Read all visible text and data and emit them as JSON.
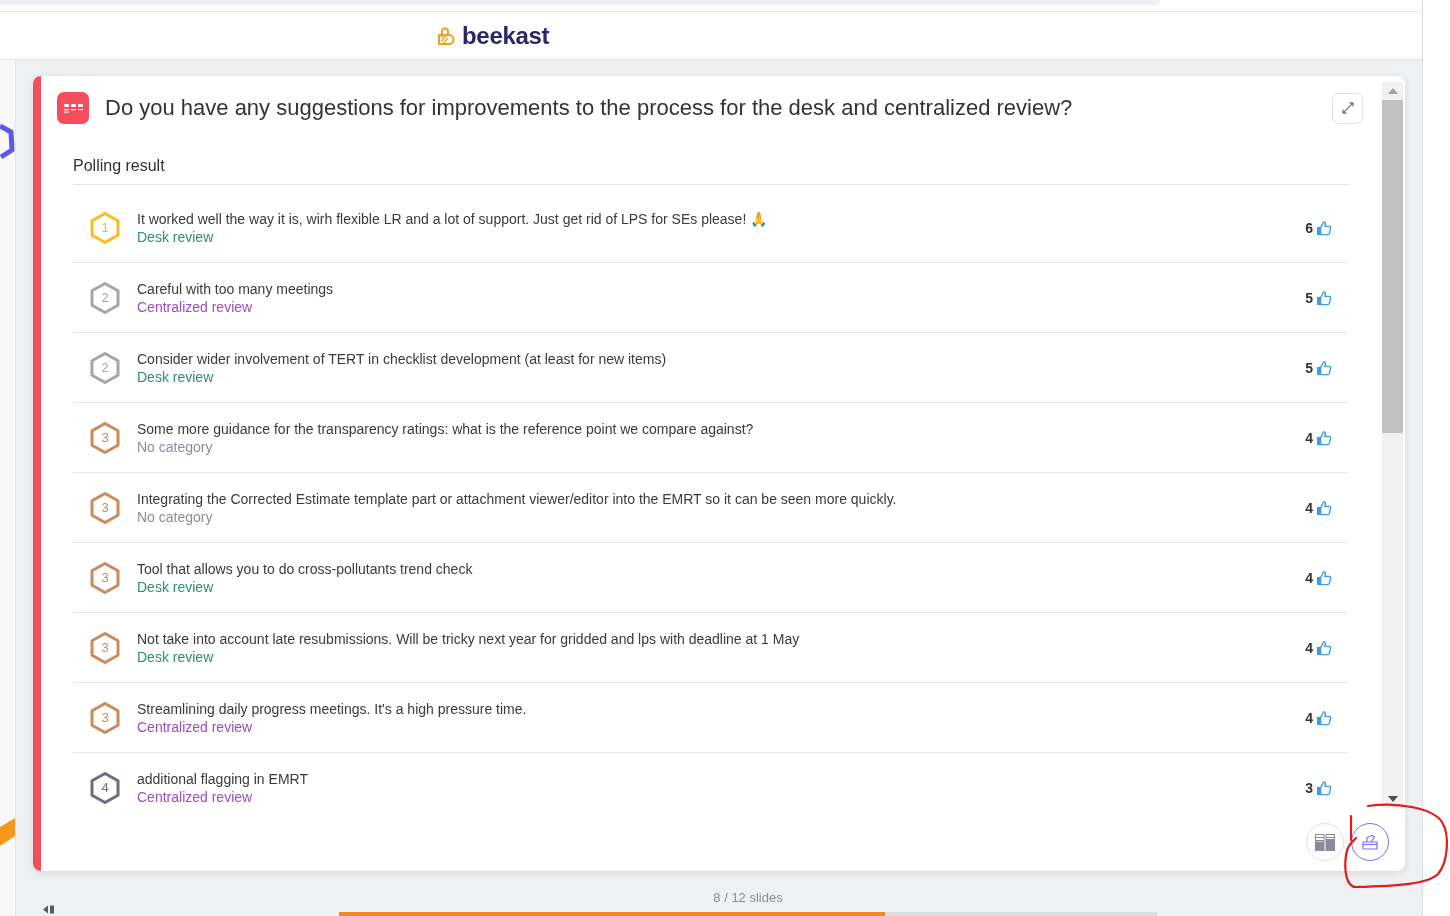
{
  "header": {
    "logo_text": "beekast"
  },
  "question": {
    "title": "Do you have any suggestions for improvements to the process for the desk and centralized review?",
    "section_title": "Polling result"
  },
  "results": [
    {
      "badge": {
        "rank": "1",
        "color": "#f5bd1f"
      },
      "text": "It worked well the way it is, wirh flexible LR and a lot of support. Just get rid of LPS for SEs please! 🙏",
      "category": {
        "label": "Desk review",
        "color": "#2b8f74"
      },
      "votes": "6"
    },
    {
      "badge": {
        "rank": "2",
        "color": "#a6a6a6"
      },
      "text": "Careful with too many meetings",
      "category": {
        "label": "Centralized review",
        "color": "#9b4dc2"
      },
      "votes": "5"
    },
    {
      "badge": {
        "rank": "2",
        "color": "#a6a6a6"
      },
      "text": "Consider wider involvement of TERT in checklist development (at least for new items)",
      "category": {
        "label": "Desk review",
        "color": "#2b8f74"
      },
      "votes": "5"
    },
    {
      "badge": {
        "rank": "3",
        "color": "#c98b5b"
      },
      "text": "Some more guidance for the transparency ratings: what is the reference point we compare against?",
      "category": {
        "label": "No category",
        "color": "#8c8c9c"
      },
      "votes": "4"
    },
    {
      "badge": {
        "rank": "3",
        "color": "#c98b5b"
      },
      "text": "Integrating the Corrected Estimate template part or attachment viewer/editor into the EMRT so it can be seen more quickly.",
      "category": {
        "label": "No category",
        "color": "#8c8c9c"
      },
      "votes": "4"
    },
    {
      "badge": {
        "rank": "3",
        "color": "#c98b5b"
      },
      "text": "Tool that allows you to do cross-pollutants trend check",
      "category": {
        "label": "Desk review",
        "color": "#2b8f74"
      },
      "votes": "4"
    },
    {
      "badge": {
        "rank": "3",
        "color": "#c98b5b"
      },
      "text": "Not take into account late resubmissions. Will be tricky next year for gridded and lps with deadline at 1 May",
      "category": {
        "label": "Desk review",
        "color": "#2b8f74"
      },
      "votes": "4"
    },
    {
      "badge": {
        "rank": "3",
        "color": "#c98b5b"
      },
      "text": "Streamlining daily progress meetings. It's a high pressure time.",
      "category": {
        "label": "Centralized review",
        "color": "#9b4dc2"
      },
      "votes": "4"
    },
    {
      "badge": {
        "rank": "4",
        "color": "#6c6c7c"
      },
      "text": "additional flagging in EMRT",
      "category": {
        "label": "Centralized review",
        "color": "#9b4dc2"
      },
      "votes": "3"
    }
  ],
  "view_buttons": [
    {
      "kind": "layout",
      "selected": false
    },
    {
      "kind": "ballot",
      "selected": true
    }
  ],
  "footer": {
    "slides": "8 / 12 slides",
    "progress": {
      "level": 0.667
    }
  }
}
